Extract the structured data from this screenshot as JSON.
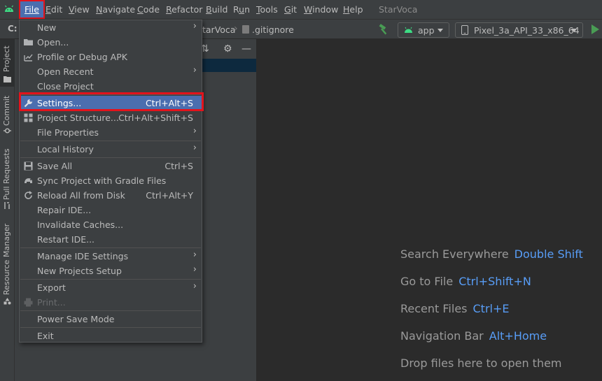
{
  "menubar": {
    "items": [
      {
        "label": "File",
        "u": "F"
      },
      {
        "label": "Edit",
        "u": "E"
      },
      {
        "label": "View",
        "u": "V"
      },
      {
        "label": "Navigate",
        "u": "N"
      },
      {
        "label": "Code",
        "u": "C"
      },
      {
        "label": "Refactor",
        "u": "R"
      },
      {
        "label": "Build",
        "u": "B"
      },
      {
        "label": "Run",
        "u": "u"
      },
      {
        "label": "Tools",
        "u": "T"
      },
      {
        "label": "Git",
        "u": "G"
      },
      {
        "label": "Window",
        "u": "W"
      },
      {
        "label": "Help",
        "u": "H"
      }
    ],
    "window_title": "StarVoca"
  },
  "toolbar": {
    "breadcrumb_root": "C:",
    "breadcrumb_project": "tarVoca",
    "breadcrumb_file": ".gitignore",
    "run_config": "app",
    "device": "Pixel_3a_API_33_x86_64"
  },
  "left_strip": {
    "tabs": [
      "Project",
      "Commit",
      "Pull Requests",
      "Resource Manager"
    ]
  },
  "file_menu": {
    "items": [
      {
        "label": "New",
        "submenu": true
      },
      {
        "label": "Open...",
        "icon": "folder-icon"
      },
      {
        "label": "Profile or Debug APK",
        "icon": "profile-apk-icon"
      },
      {
        "label": "Open Recent",
        "submenu": true
      },
      {
        "label": "Close Project"
      },
      {
        "label": "Settings...",
        "shortcut": "Ctrl+Alt+S",
        "icon": "wrench-icon",
        "highlighted": true
      },
      {
        "label": "Project Structure...",
        "shortcut": "Ctrl+Alt+Shift+S",
        "icon": "project-structure-icon"
      },
      {
        "label": "File Properties",
        "submenu": true
      },
      {
        "label": "Local History",
        "submenu": true
      },
      {
        "label": "Save All",
        "shortcut": "Ctrl+S",
        "icon": "save-icon"
      },
      {
        "label": "Sync Project with Gradle Files",
        "icon": "gradle-sync-icon"
      },
      {
        "label": "Reload All from Disk",
        "shortcut": "Ctrl+Alt+Y",
        "icon": "reload-icon"
      },
      {
        "label": "Repair IDE..."
      },
      {
        "label": "Invalidate Caches..."
      },
      {
        "label": "Restart IDE..."
      },
      {
        "label": "Manage IDE Settings",
        "submenu": true
      },
      {
        "label": "New Projects Setup",
        "submenu": true
      },
      {
        "label": "Export",
        "submenu": true
      },
      {
        "label": "Print...",
        "icon": "print-icon",
        "disabled": true
      },
      {
        "label": "Power Save Mode"
      },
      {
        "label": "Exit"
      }
    ]
  },
  "editor": {
    "hints": [
      {
        "label": "Search Everywhere",
        "shortcut": "Double Shift"
      },
      {
        "label": "Go to File",
        "shortcut": "Ctrl+Shift+N"
      },
      {
        "label": "Recent Files",
        "shortcut": "Ctrl+E"
      },
      {
        "label": "Navigation Bar",
        "shortcut": "Alt+Home"
      },
      {
        "label": "Drop files here to open them",
        "shortcut": ""
      }
    ]
  },
  "colors": {
    "accent": "#4b6eaf",
    "highlight_box": "#e3131c",
    "link": "#589df6",
    "android_green": "#3ddc84"
  }
}
